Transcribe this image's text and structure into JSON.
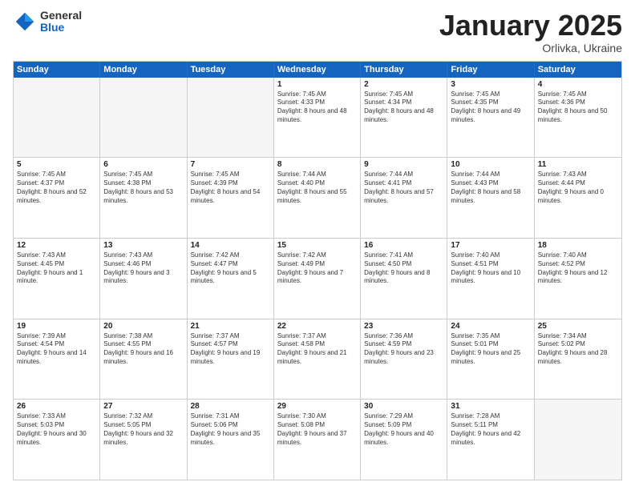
{
  "header": {
    "logo": {
      "general": "General",
      "blue": "Blue"
    },
    "title": "January 2025",
    "location": "Orlivka, Ukraine"
  },
  "weekdays": [
    "Sunday",
    "Monday",
    "Tuesday",
    "Wednesday",
    "Thursday",
    "Friday",
    "Saturday"
  ],
  "rows": [
    [
      {
        "day": "",
        "text": "",
        "empty": true
      },
      {
        "day": "",
        "text": "",
        "empty": true
      },
      {
        "day": "",
        "text": "",
        "empty": true
      },
      {
        "day": "1",
        "text": "Sunrise: 7:45 AM\nSunset: 4:33 PM\nDaylight: 8 hours and 48 minutes."
      },
      {
        "day": "2",
        "text": "Sunrise: 7:45 AM\nSunset: 4:34 PM\nDaylight: 8 hours and 48 minutes."
      },
      {
        "day": "3",
        "text": "Sunrise: 7:45 AM\nSunset: 4:35 PM\nDaylight: 8 hours and 49 minutes."
      },
      {
        "day": "4",
        "text": "Sunrise: 7:45 AM\nSunset: 4:36 PM\nDaylight: 8 hours and 50 minutes."
      }
    ],
    [
      {
        "day": "5",
        "text": "Sunrise: 7:45 AM\nSunset: 4:37 PM\nDaylight: 8 hours and 52 minutes."
      },
      {
        "day": "6",
        "text": "Sunrise: 7:45 AM\nSunset: 4:38 PM\nDaylight: 8 hours and 53 minutes."
      },
      {
        "day": "7",
        "text": "Sunrise: 7:45 AM\nSunset: 4:39 PM\nDaylight: 8 hours and 54 minutes."
      },
      {
        "day": "8",
        "text": "Sunrise: 7:44 AM\nSunset: 4:40 PM\nDaylight: 8 hours and 55 minutes."
      },
      {
        "day": "9",
        "text": "Sunrise: 7:44 AM\nSunset: 4:41 PM\nDaylight: 8 hours and 57 minutes."
      },
      {
        "day": "10",
        "text": "Sunrise: 7:44 AM\nSunset: 4:43 PM\nDaylight: 8 hours and 58 minutes."
      },
      {
        "day": "11",
        "text": "Sunrise: 7:43 AM\nSunset: 4:44 PM\nDaylight: 9 hours and 0 minutes."
      }
    ],
    [
      {
        "day": "12",
        "text": "Sunrise: 7:43 AM\nSunset: 4:45 PM\nDaylight: 9 hours and 1 minute."
      },
      {
        "day": "13",
        "text": "Sunrise: 7:43 AM\nSunset: 4:46 PM\nDaylight: 9 hours and 3 minutes."
      },
      {
        "day": "14",
        "text": "Sunrise: 7:42 AM\nSunset: 4:47 PM\nDaylight: 9 hours and 5 minutes."
      },
      {
        "day": "15",
        "text": "Sunrise: 7:42 AM\nSunset: 4:49 PM\nDaylight: 9 hours and 7 minutes."
      },
      {
        "day": "16",
        "text": "Sunrise: 7:41 AM\nSunset: 4:50 PM\nDaylight: 9 hours and 8 minutes."
      },
      {
        "day": "17",
        "text": "Sunrise: 7:40 AM\nSunset: 4:51 PM\nDaylight: 9 hours and 10 minutes."
      },
      {
        "day": "18",
        "text": "Sunrise: 7:40 AM\nSunset: 4:52 PM\nDaylight: 9 hours and 12 minutes."
      }
    ],
    [
      {
        "day": "19",
        "text": "Sunrise: 7:39 AM\nSunset: 4:54 PM\nDaylight: 9 hours and 14 minutes."
      },
      {
        "day": "20",
        "text": "Sunrise: 7:38 AM\nSunset: 4:55 PM\nDaylight: 9 hours and 16 minutes."
      },
      {
        "day": "21",
        "text": "Sunrise: 7:37 AM\nSunset: 4:57 PM\nDaylight: 9 hours and 19 minutes."
      },
      {
        "day": "22",
        "text": "Sunrise: 7:37 AM\nSunset: 4:58 PM\nDaylight: 9 hours and 21 minutes."
      },
      {
        "day": "23",
        "text": "Sunrise: 7:36 AM\nSunset: 4:59 PM\nDaylight: 9 hours and 23 minutes."
      },
      {
        "day": "24",
        "text": "Sunrise: 7:35 AM\nSunset: 5:01 PM\nDaylight: 9 hours and 25 minutes."
      },
      {
        "day": "25",
        "text": "Sunrise: 7:34 AM\nSunset: 5:02 PM\nDaylight: 9 hours and 28 minutes."
      }
    ],
    [
      {
        "day": "26",
        "text": "Sunrise: 7:33 AM\nSunset: 5:03 PM\nDaylight: 9 hours and 30 minutes."
      },
      {
        "day": "27",
        "text": "Sunrise: 7:32 AM\nSunset: 5:05 PM\nDaylight: 9 hours and 32 minutes."
      },
      {
        "day": "28",
        "text": "Sunrise: 7:31 AM\nSunset: 5:06 PM\nDaylight: 9 hours and 35 minutes."
      },
      {
        "day": "29",
        "text": "Sunrise: 7:30 AM\nSunset: 5:08 PM\nDaylight: 9 hours and 37 minutes."
      },
      {
        "day": "30",
        "text": "Sunrise: 7:29 AM\nSunset: 5:09 PM\nDaylight: 9 hours and 40 minutes."
      },
      {
        "day": "31",
        "text": "Sunrise: 7:28 AM\nSunset: 5:11 PM\nDaylight: 9 hours and 42 minutes."
      },
      {
        "day": "",
        "text": "",
        "empty": true
      }
    ]
  ]
}
